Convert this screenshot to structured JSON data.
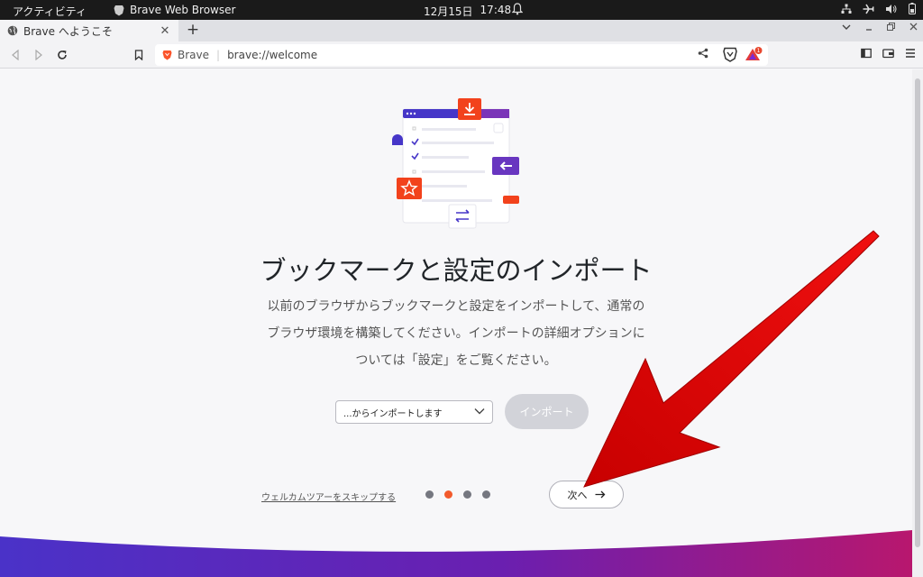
{
  "system": {
    "activities": "アクティビティ",
    "app_name": "Brave Web Browser",
    "date": "12月15日",
    "time": "17:48"
  },
  "tab": {
    "title": "Brave へようこそ"
  },
  "address": {
    "site_label": "Brave",
    "url": "brave://welcome",
    "rewards_badge": "1"
  },
  "main": {
    "title": "ブックマークと設定のインポート",
    "description": "以前のブラウザからブックマークと設定をインポートして、通常のブラウザ環境を構築してください。インポートの詳細オプションについては「設定」をご覧ください。",
    "select_value": "...からインポートします",
    "import_label": "インポート",
    "skip_label": "ウェルカムツアーをスキップする",
    "next_label": "次へ",
    "steps_total": 4,
    "steps_current": 2
  },
  "colors": {
    "accent": "#f25a2c",
    "purple": "#4434c4",
    "annotation_arrow": "#e00000"
  }
}
